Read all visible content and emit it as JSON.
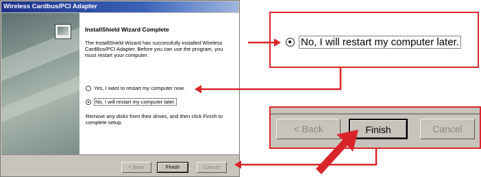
{
  "window": {
    "title": "Wireless Cardbus/PCI Adapter"
  },
  "wizard": {
    "heading": "InstallShield Wizard Complete",
    "message": "The InstallShield Wizard has successfully installed Wireless CardBus/PCI Adapter.  Before you can use the program, you must restart your computer.",
    "options": [
      {
        "label": "Yes, I want to restart my computer now.",
        "selected": false
      },
      {
        "label": "No, I will restart my computer later.",
        "selected": true
      }
    ],
    "remove_text": "Remove any disks from their drives, and then click Finish to complete setup.",
    "buttons": {
      "back": "< Back",
      "finish": "Finish",
      "cancel": "Cancel"
    }
  },
  "zoom_option": {
    "label": "No, I will restart my computer later."
  },
  "zoom_buttons": {
    "back": "< Back",
    "finish": "Finish",
    "cancel": "Cancel"
  },
  "colors": {
    "accent": "#d9252a",
    "titlebar": "#1c2f86",
    "dialog_bg": "#c8c4bc"
  }
}
